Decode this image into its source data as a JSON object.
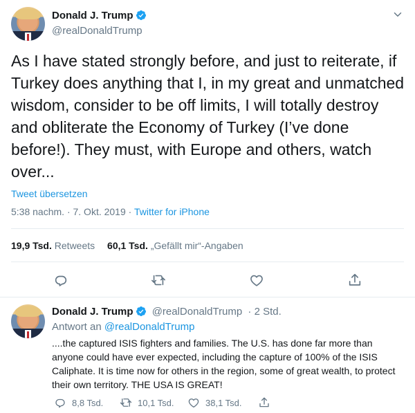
{
  "main_tweet": {
    "author_name": "Donald J. Trump",
    "author_handle": "@realDonaldTrump",
    "text": "As I have stated strongly before, and just to reiterate, if Turkey does anything that I, in my great and unmatched wisdom, consider to be off limits, I will totally destroy and obliterate the Economy of Turkey (I’ve done before!). They must, with Europe and others, watch over...",
    "translate_label": "Tweet übersetzen",
    "timestamp": "5:38 nachm. · 7. Okt. 2019",
    "separator": "·",
    "source": "Twitter for iPhone",
    "retweets_count": "19,9 Tsd.",
    "retweets_label": "Retweets",
    "likes_count": "60,1 Tsd.",
    "likes_label": "„Gefällt mir“-Angaben"
  },
  "reply_tweet": {
    "author_name": "Donald J. Trump",
    "author_handle": "@realDonaldTrump",
    "time_ago": "· 2 Std.",
    "reply_prefix": "Antwort an",
    "reply_to": "@realDonaldTrump",
    "text": "....the captured ISIS fighters and families. The U.S. has done far more than anyone could have ever expected, including the capture of 100% of the ISIS Caliphate. It is time now for others in the region, some of great wealth, to protect their own territory. THE USA IS GREAT!",
    "reply_count": "8,8 Tsd.",
    "retweet_count": "10,1 Tsd.",
    "like_count": "38,1 Tsd."
  },
  "colors": {
    "accent": "#1b95e0",
    "muted": "#657786",
    "text": "#14171a",
    "divider": "#e6ecf0"
  },
  "icons": [
    "verified-badge-icon",
    "chevron-down-icon",
    "reply-icon",
    "retweet-icon",
    "like-icon",
    "share-icon"
  ]
}
